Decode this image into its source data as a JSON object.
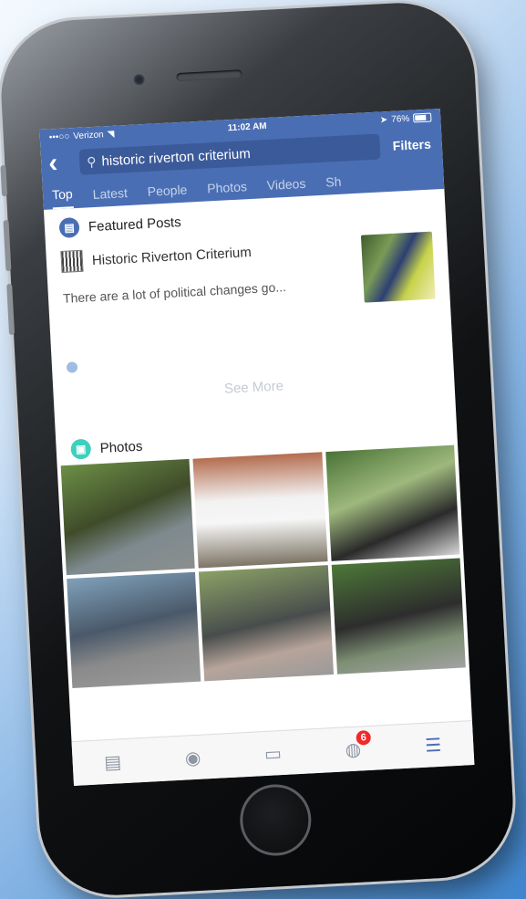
{
  "status_bar": {
    "carrier": "Verizon",
    "time": "11:02 AM",
    "battery": "76%"
  },
  "search": {
    "query": "historic riverton criterium",
    "filters_label": "Filters"
  },
  "tabs": [
    {
      "label": "Top"
    },
    {
      "label": "Latest"
    },
    {
      "label": "People"
    },
    {
      "label": "Photos"
    },
    {
      "label": "Videos"
    },
    {
      "label": "Sh"
    }
  ],
  "featured": {
    "title": "Featured Posts",
    "post_author": "Historic Riverton Criterium",
    "post_snippet": "There are a lot of political changes go..."
  },
  "see_more": "See More",
  "photos": {
    "title": "Photos"
  },
  "bottom_bar": {
    "notification_count": "6"
  },
  "colors": {
    "nav_blue": "#4a6eb3",
    "badge_red": "#f02a2a",
    "photos_icon": "#3fcfbe"
  }
}
